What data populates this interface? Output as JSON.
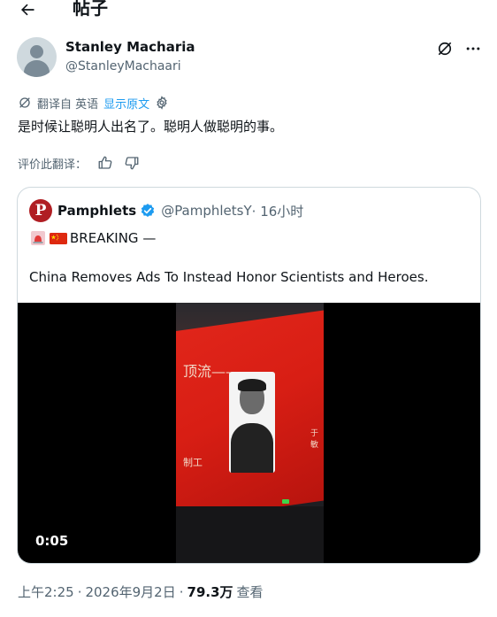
{
  "header": {
    "title": "帖子",
    "back_icon": "arrow-left-icon"
  },
  "author": {
    "name": "Stanley Macharia",
    "handle": "@StanleyMachaari"
  },
  "translation": {
    "label": "翻译自 英语",
    "show_original": "显示原文"
  },
  "tweet": {
    "text": "是时候让聪明人出名了。聪明人做聪明的事。"
  },
  "rate": {
    "label": "评价此翻译："
  },
  "quote": {
    "logo_letter": "P",
    "name": "Pamphlets",
    "handle": "@PamphletsY",
    "time": " · 16小时",
    "breaking": "BREAKING —",
    "body": "China Removes Ads To Instead Honor Scientists and Heroes.",
    "video": {
      "duration": "0:05",
      "screen_text_1": "顶流——",
      "screen_text_2": "制工",
      "screen_text_4": "于敏"
    }
  },
  "meta": {
    "time": "上午2:25",
    "sep": "·",
    "date": "2026年9月2日",
    "sep2": "·",
    "views": "79.3万",
    "views_label": "查看"
  },
  "colors": {
    "accent": "#1d9bf0",
    "secondary": "#536471",
    "text": "#0f1419",
    "logo": "#b01e23"
  }
}
